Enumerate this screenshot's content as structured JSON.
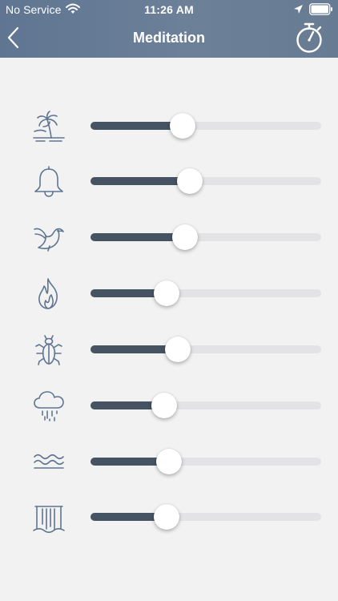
{
  "status_bar": {
    "carrier": "No Service",
    "time": "11:26 AM",
    "icons": [
      "wifi-icon",
      "location-arrow-icon",
      "battery-icon"
    ]
  },
  "nav": {
    "title": "Meditation",
    "back_icon": "chevron-left-icon",
    "timer_icon": "stopwatch-icon"
  },
  "colors": {
    "header": "#6c8098",
    "background": "#f2f2f2",
    "icon": "#5f7591",
    "slider_fill": "#465362",
    "slider_track": "#e3e3e5",
    "thumb": "#ffffff"
  },
  "sounds": [
    {
      "icon": "palm-island-icon",
      "volume": 0.4
    },
    {
      "icon": "bell-icon",
      "volume": 0.43
    },
    {
      "icon": "dove-icon",
      "volume": 0.41
    },
    {
      "icon": "fire-icon",
      "volume": 0.33
    },
    {
      "icon": "insect-icon",
      "volume": 0.38
    },
    {
      "icon": "rain-cloud-icon",
      "volume": 0.32
    },
    {
      "icon": "waves-icon",
      "volume": 0.34
    },
    {
      "icon": "waterfall-icon",
      "volume": 0.33
    }
  ]
}
